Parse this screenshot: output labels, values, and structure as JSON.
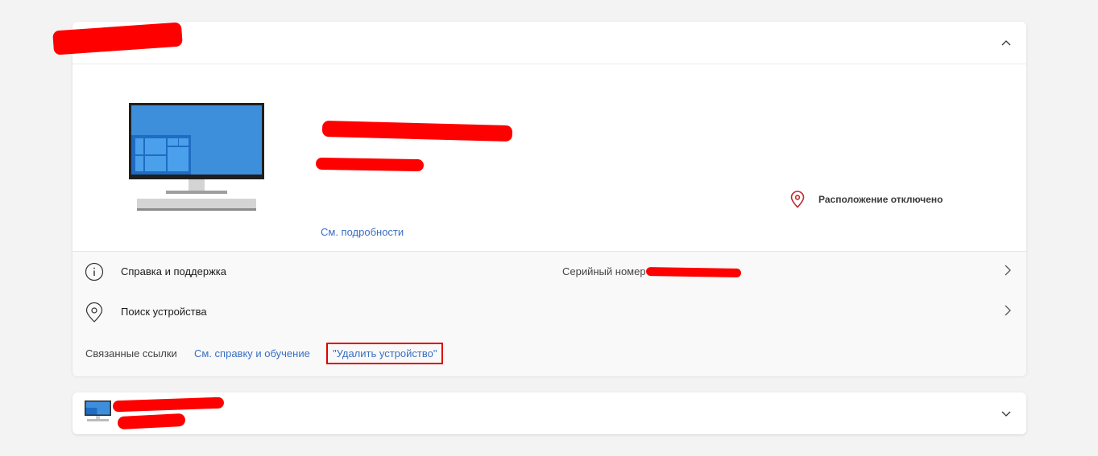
{
  "device_card": {
    "details_link": "См. подробности",
    "location_status": "Расположение отключено",
    "rows": [
      {
        "label": "Справка и поддержка"
      },
      {
        "label": "Поиск устройства"
      }
    ],
    "serial_label": "Серийный номер",
    "related_links_label": "Связанные ссылки",
    "help_link": "См. справку и обучение",
    "remove_device_link": "\"Удалить устройство\""
  },
  "colors": {
    "accent_link": "#3a6fc2",
    "redaction": "#ff0000",
    "highlight_box": "#e00000",
    "location_icon": "#c0282d"
  },
  "icons": [
    "chevron-up-icon",
    "monitor-icon",
    "location-pin-icon",
    "info-icon",
    "chevron-right-icon",
    "chevron-down-icon",
    "small-monitor-icon"
  ]
}
